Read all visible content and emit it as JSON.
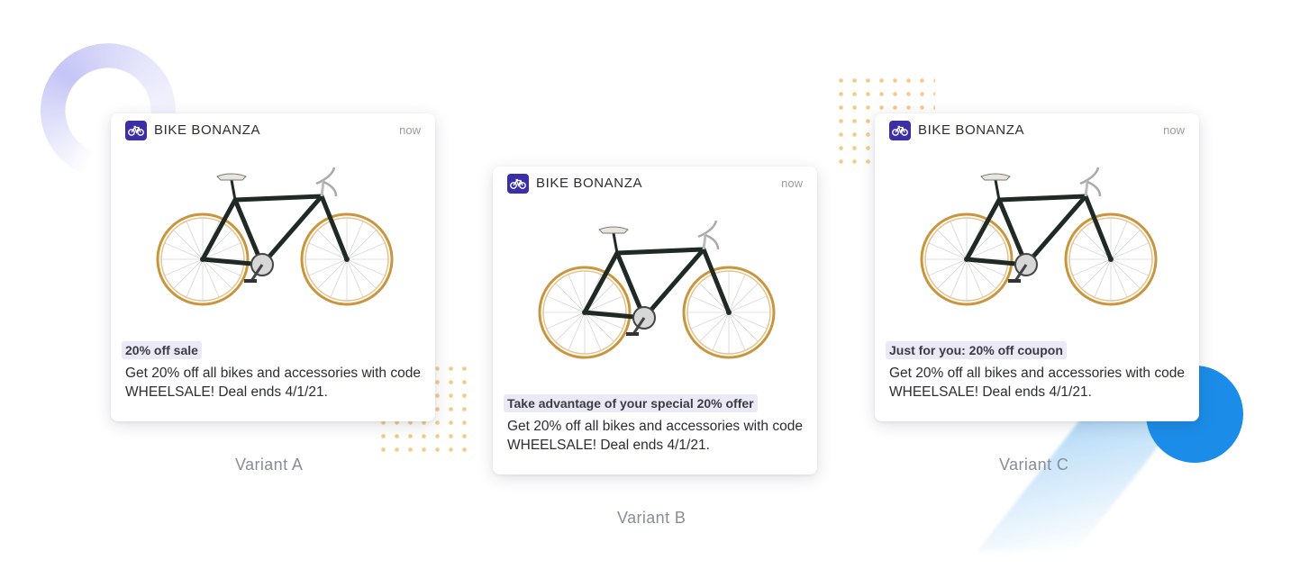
{
  "variants": [
    {
      "app_name": "BIKE BONANZA",
      "time": "now",
      "headline": "20% off sale",
      "body": "Get 20% off all bikes and accessories with code WHEELSALE! Deal ends 4/1/21.",
      "label": "Variant A"
    },
    {
      "app_name": "BIKE BONANZA",
      "time": "now",
      "headline": "Take advantage of your special 20% offer",
      "body": "Get 20% off all bikes and accessories with code WHEELSALE! Deal ends 4/1/21.",
      "label": "Variant B"
    },
    {
      "app_name": "BIKE BONANZA",
      "time": "now",
      "headline": "Just for you: 20% off coupon",
      "body": "Get 20% off all bikes and accessories with code WHEELSALE! Deal ends 4/1/21.",
      "label": "Variant C"
    }
  ],
  "icons": {
    "app": "bicycle-icon",
    "product": "bicycle-photo"
  },
  "colors": {
    "brand": "#3a2fa6",
    "highlight": "#ece9f7",
    "accent_blue": "#1b8de8",
    "dots": "#f8c98b"
  }
}
